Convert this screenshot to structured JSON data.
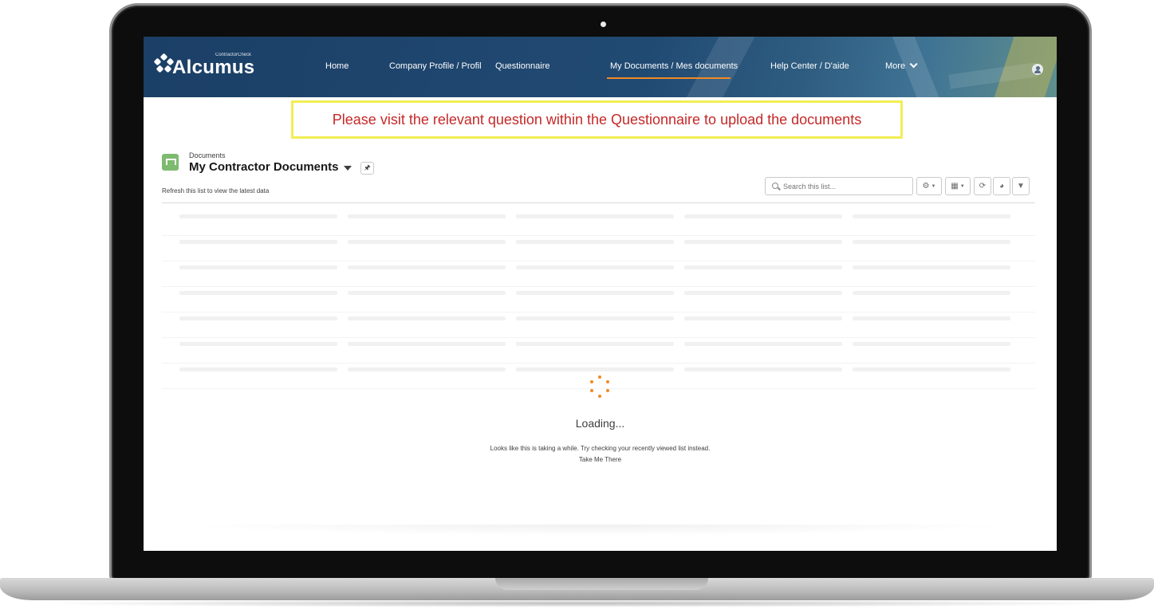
{
  "header": {
    "logo_text": "Alcumus",
    "logo_sub": "ContractorCheck",
    "nav": {
      "home": "Home",
      "company_profile": "Company Profile / Profil",
      "questionnaire": "Questionnaire",
      "my_documents": "My Documents / Mes documents",
      "help_center": "Help Center / D'aide",
      "more": "More"
    },
    "active_nav": "My Documents / Mes documents",
    "accent_color": "#f08a24"
  },
  "banner": {
    "text": "Please visit the relevant question within the Questionnaire to upload the documents",
    "text_color": "#c62828",
    "border_color": "#f2ee54"
  },
  "list": {
    "object_label": "Documents",
    "title": "My Contractor Documents",
    "refresh_note": "Refresh this list to view the latest data",
    "search_placeholder": "Search this list...",
    "toolbar_icons": [
      "gear-icon",
      "table-view-icon",
      "refresh-icon",
      "chart-icon",
      "filter-icon"
    ]
  },
  "loading": {
    "title": "Loading...",
    "message": "Looks like this is taking a while. Try checking your recently viewed list instead.",
    "link": "Take Me There"
  }
}
